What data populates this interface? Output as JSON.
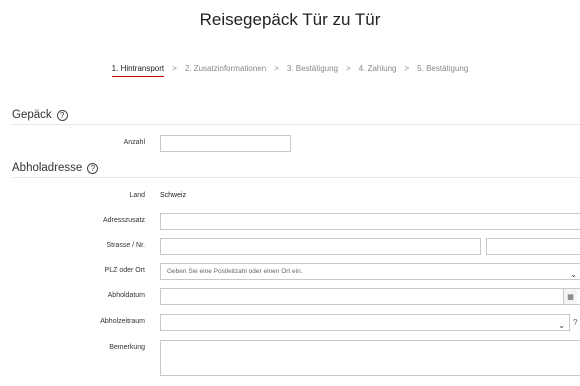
{
  "page": {
    "title": "Reisegepäck Tür zu Tür"
  },
  "steps": [
    {
      "label": "1. Hintransport",
      "active": true
    },
    {
      "label": "2. Zusatzinformationen",
      "active": false
    },
    {
      "label": "3. Bestätigung",
      "active": false
    },
    {
      "label": "4. Zahlung",
      "active": false
    },
    {
      "label": "5. Bestätigung",
      "active": false
    }
  ],
  "step_separator": ">",
  "gepaeck": {
    "title": "Gepäck",
    "help_icon": "?",
    "anzahl_label": "Anzahl",
    "anzahl_value": ""
  },
  "abholadresse": {
    "title": "Abholadresse",
    "help_icon": "?",
    "land_label": "Land",
    "land_value": "Schweiz",
    "adresszusatz_label": "Adresszusatz",
    "strasse_label": "Strasse / Nr.",
    "plz_label": "PLZ oder Ort",
    "plz_placeholder": "Geben Sie eine Postleitzahl oder einen Ort ein.",
    "abholdatum_label": "Abholdatum",
    "abholzeitraum_label": "Abholzeitraum",
    "bemerkung_label": "Bemerkung"
  },
  "icons": {
    "chevron": "⌄",
    "calendar": "▦",
    "help": "?"
  },
  "colors": {
    "active_step_underline": "#cc0000",
    "border": "#c8c8c8",
    "text": "#333333"
  }
}
